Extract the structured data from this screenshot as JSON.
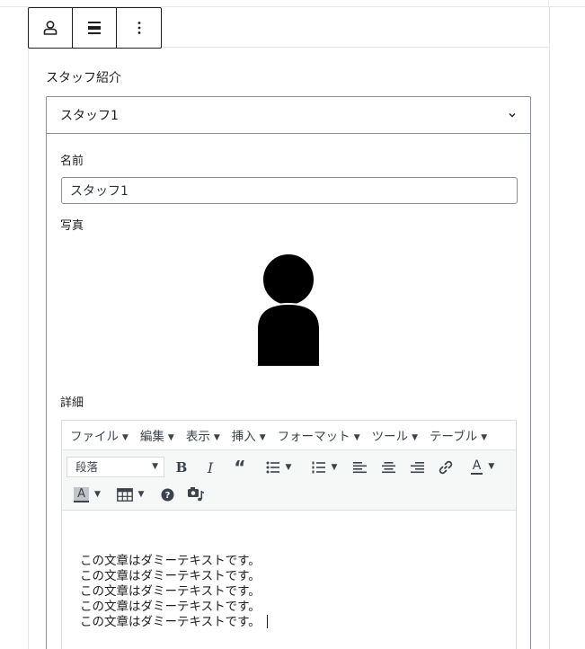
{
  "block": {
    "toolbar_icons": [
      "person-icon",
      "align-icon",
      "more-vertical-icon"
    ],
    "section_title": "スタッフ紹介"
  },
  "staff": {
    "item_title": "スタッフ1",
    "name_label": "名前",
    "name_value": "スタッフ1",
    "photo_label": "写真",
    "detail_label": "詳細"
  },
  "editor": {
    "menus": [
      "ファイル",
      "編集",
      "表示",
      "挿入",
      "フォーマット",
      "ツール",
      "テーブル"
    ],
    "format_select": "段落",
    "content_lines": [
      "この文章はダミーテキストです。",
      "この文章はダミーテキストです。",
      "この文章はダミーテキストです。",
      "この文章はダミーテキストです。",
      "この文章はダミーテキストです。"
    ]
  }
}
